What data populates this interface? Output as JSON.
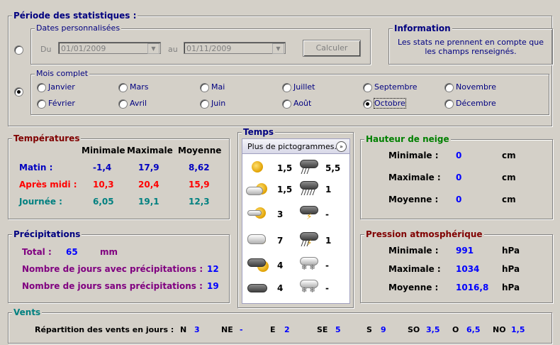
{
  "periode": {
    "title": "Période des statistiques :",
    "dates_title": "Dates personnalisées",
    "du_label": "Du",
    "du_value": "01/01/2009",
    "au_label": "au",
    "au_value": "01/11/2009",
    "calculer": "Calculer",
    "info_title": "Information",
    "info_text_1": "Les stats ne prennent en compte que",
    "info_text_2": "les champs renseignés.",
    "mois_title": "Mois complet",
    "months": [
      "Janvier",
      "Mars",
      "Mai",
      "Juillet",
      "Septembre",
      "Novembre",
      "Février",
      "Avril",
      "Juin",
      "Août",
      "Octobre",
      "Décembre"
    ],
    "selected_month": "Octobre"
  },
  "temperatures": {
    "title": "Températures",
    "headers": [
      "Minimale",
      "Maximale",
      "Moyenne"
    ],
    "rows": [
      {
        "label": "Matin :",
        "min": "-1,4",
        "max": "17,9",
        "moy": "8,62",
        "color": "#0000c0"
      },
      {
        "label": "Après midi :",
        "min": "10,3",
        "max": "20,4",
        "moy": "15,9",
        "color": "#ff0000"
      },
      {
        "label": "Journée :",
        "min": "6,05",
        "max": "19,1",
        "moy": "12,3",
        "color": "#008080"
      }
    ]
  },
  "temps": {
    "title": "Temps",
    "dropdown": "Plus de pictogrammes...",
    "left_values": [
      "1,5",
      "1,5",
      "3",
      "7",
      "4",
      "4"
    ],
    "right_values": [
      "5,5",
      "1",
      "-",
      "1",
      "-",
      "-"
    ]
  },
  "neige": {
    "title": "Hauteur de neige",
    "rows": [
      {
        "label": "Minimale :",
        "value": "0",
        "unit": "cm"
      },
      {
        "label": "Maximale :",
        "value": "0",
        "unit": "cm"
      },
      {
        "label": "Moyenne :",
        "value": "0",
        "unit": "cm"
      }
    ]
  },
  "precip": {
    "title": "Précipitations",
    "total_label": "Total :",
    "total_value": "65",
    "total_unit": "mm",
    "avec_label": "Nombre de jours avec précipitations :",
    "avec_value": "12",
    "sans_label": "Nombre de jours sans précipitations :",
    "sans_value": "19"
  },
  "pression": {
    "title": "Pression atmosphérique",
    "rows": [
      {
        "label": "Minimale :",
        "value": "991",
        "unit": "hPa"
      },
      {
        "label": "Maximale :",
        "value": "1034",
        "unit": "hPa"
      },
      {
        "label": "Moyenne :",
        "value": "1016,8",
        "unit": "hPa"
      }
    ]
  },
  "vents": {
    "title": "Vents",
    "label": "Répartition des vents en jours :",
    "dirs": [
      {
        "d": "N",
        "v": "3"
      },
      {
        "d": "NE",
        "v": "-"
      },
      {
        "d": "E",
        "v": "2"
      },
      {
        "d": "SE",
        "v": "5"
      },
      {
        "d": "S",
        "v": "9"
      },
      {
        "d": "SO",
        "v": "3,5"
      },
      {
        "d": "O",
        "v": "6,5"
      },
      {
        "d": "NO",
        "v": "1,5"
      }
    ]
  },
  "colors": {
    "navy": "#000080",
    "dark_red": "#800000",
    "dark_green": "#008000",
    "purple": "#800080",
    "teal": "#008080"
  }
}
